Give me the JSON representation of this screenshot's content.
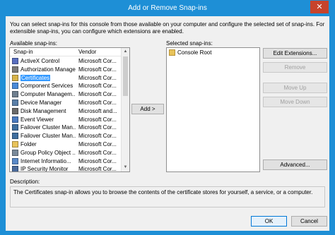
{
  "window": {
    "title": "Add or Remove Snap-ins",
    "close_glyph": "✕"
  },
  "intro": "You can select snap-ins for this console from those available on your computer and configure the selected set of snap-ins. For extensible snap-ins, you can configure which extensions are enabled.",
  "available": {
    "label": "Available snap-ins:",
    "col_snapin": "Snap-in",
    "col_vendor": "Vendor",
    "rows": [
      {
        "name": "ActiveX Control",
        "vendor": "Microsoft Cor...",
        "icon": "activex-icon",
        "color": "#5a6fbf"
      },
      {
        "name": "Authorization Manager",
        "vendor": "Microsoft Cor...",
        "icon": "authorization-manager-icon",
        "color": "#7a7a7a"
      },
      {
        "name": "Certificates",
        "vendor": "Microsoft Cor...",
        "icon": "certificates-icon",
        "color": "#d8b44a",
        "selected": true
      },
      {
        "name": "Component Services",
        "vendor": "Microsoft Cor...",
        "icon": "component-services-icon",
        "color": "#4a8ad8"
      },
      {
        "name": "Computer Managem...",
        "vendor": "Microsoft Cor...",
        "icon": "computer-management-icon",
        "color": "#6f7f8f"
      },
      {
        "name": "Device Manager",
        "vendor": "Microsoft Cor...",
        "icon": "device-manager-icon",
        "color": "#5a7fa8"
      },
      {
        "name": "Disk Management",
        "vendor": "Microsoft and...",
        "icon": "disk-management-icon",
        "color": "#6a6a6a"
      },
      {
        "name": "Event Viewer",
        "vendor": "Microsoft Cor...",
        "icon": "event-viewer-icon",
        "color": "#4a7abf"
      },
      {
        "name": "Failover Cluster Man...",
        "vendor": "Microsoft Cor...",
        "icon": "failover-cluster-icon",
        "color": "#3f6f9f"
      },
      {
        "name": "Failover Cluster Man...",
        "vendor": "Microsoft Cor...",
        "icon": "failover-cluster-icon",
        "color": "#3f6f9f"
      },
      {
        "name": "Folder",
        "vendor": "Microsoft Cor...",
        "icon": "folder-icon",
        "color": "#e8c35a"
      },
      {
        "name": "Group Policy Object ...",
        "vendor": "Microsoft Cor...",
        "icon": "group-policy-icon",
        "color": "#7a8a9a"
      },
      {
        "name": "Internet Informatio...",
        "vendor": "Microsoft Cor...",
        "icon": "iis-icon",
        "color": "#5a8ac8"
      },
      {
        "name": "IP Security Monitor",
        "vendor": "Microsoft Cor...",
        "icon": "ip-security-monitor-icon",
        "color": "#4a6a9a"
      }
    ]
  },
  "add_button": "Add >",
  "selected": {
    "label": "Selected snap-ins:",
    "items": [
      {
        "name": "Console Root",
        "icon": "console-root-folder-icon"
      }
    ]
  },
  "buttons": {
    "edit_extensions": "Edit Extensions...",
    "remove": "Remove",
    "move_up": "Move Up",
    "move_down": "Move Down",
    "advanced": "Advanced..."
  },
  "description": {
    "label": "Description:",
    "text": "The Certificates snap-in allows you to browse the contents of the certificate stores for yourself, a service, or a computer."
  },
  "footer": {
    "ok": "OK",
    "cancel": "Cancel"
  },
  "colors": {
    "titlebar": "#1e8fd6",
    "close": "#c7432b",
    "selection": "#3399ff"
  }
}
